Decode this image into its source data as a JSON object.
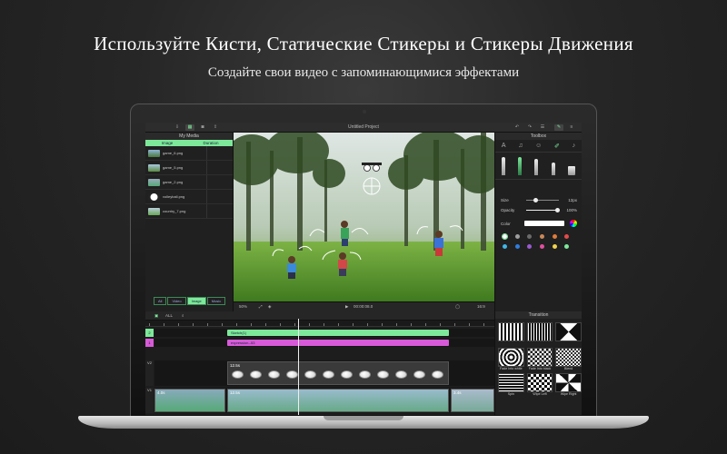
{
  "headline": "Используйте Кисти, Статические Стикеры и Стикеры Движения",
  "subheadline": "Создайте свои видео с запоминающимися эффектами",
  "app": {
    "project_title": "Untitled Project",
    "media": {
      "title": "My Media",
      "columns": [
        "Image",
        "Duration"
      ],
      "files": [
        "game_6.png",
        "game_5.png",
        "game_2.png",
        "volleyball.png",
        "country_7.png"
      ],
      "filters": [
        "All",
        "Video",
        "Image",
        "Music"
      ],
      "active_filter": "Image"
    },
    "toolbox": {
      "title": "Toolbox",
      "size_label": "Size",
      "size_value": "12px",
      "opacity_label": "Opacity",
      "opacity_value": "100%",
      "color_label": "Color",
      "accent": "#7de89a",
      "swatches": [
        "#ffffff",
        "#9e9e9e",
        "#6b6b6b",
        "#c8885a",
        "#e07a3a",
        "#e44b4b",
        "#3fb6e8",
        "#2f7de0",
        "#9b59d0",
        "#e04fa0",
        "#f2d24b",
        "#7de89a"
      ]
    },
    "preview": {
      "zoom": "50%",
      "timecode": "00:00:08.0",
      "ratio": "16:9"
    },
    "timeline": {
      "zoom_menu": "ALL",
      "tracks": [
        {
          "id": "2",
          "clip": "Sketch(1)"
        },
        {
          "id": "1",
          "clip": "expression--53"
        },
        {
          "id": "V2",
          "clip_duration": "12.5s"
        },
        {
          "id": "V1",
          "clip_durations": [
            "4.0s",
            "12.5s",
            "3.4s"
          ]
        }
      ]
    },
    "transition": {
      "title": "Transition",
      "items": [
        "",
        "",
        "",
        "Fade Into white",
        "Fade Into black",
        "Blend",
        "Spin",
        "Wipe Left",
        "Wipe Right"
      ]
    }
  }
}
